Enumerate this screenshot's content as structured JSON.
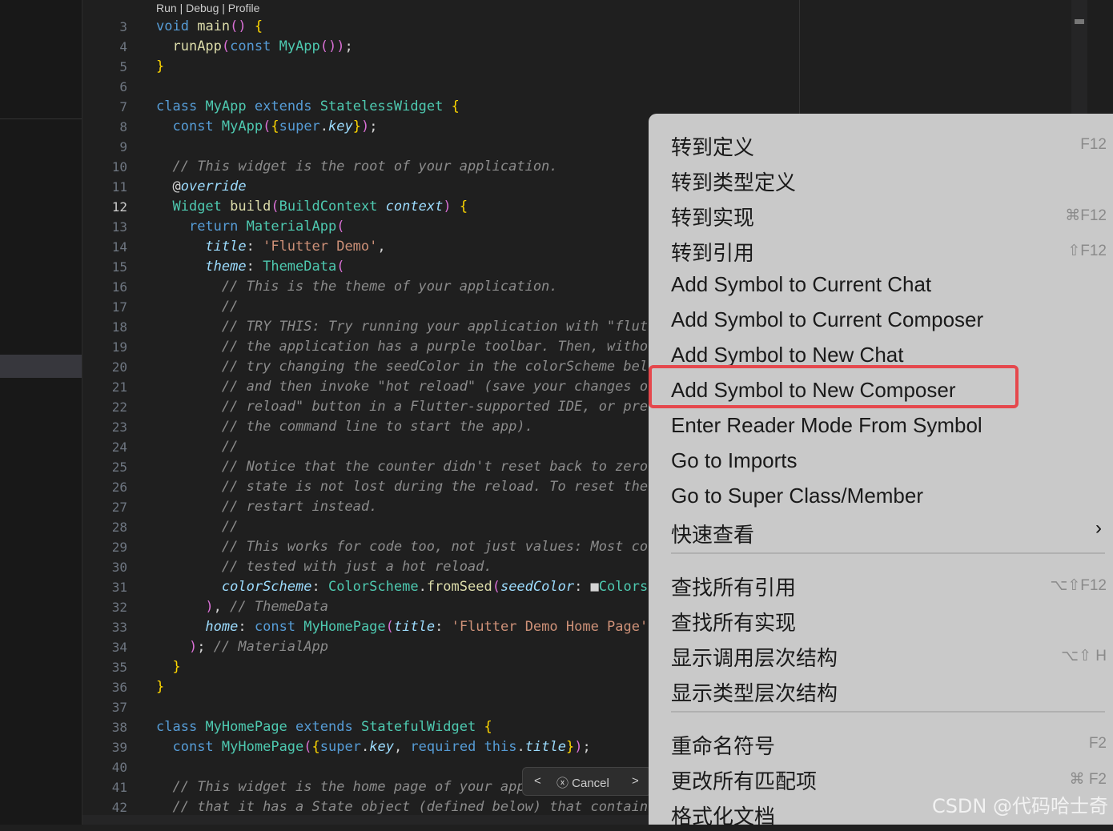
{
  "editor": {
    "codelens": "Run | Debug | Profile",
    "line_numbers": [
      "3",
      "4",
      "5",
      "6",
      "7",
      "8",
      "9",
      "10",
      "11",
      "12",
      "13",
      "14",
      "15",
      "16",
      "17",
      "18",
      "19",
      "20",
      "21",
      "22",
      "23",
      "24",
      "25",
      "26",
      "27",
      "28",
      "29",
      "30",
      "31",
      "32",
      "33",
      "34",
      "35",
      "36",
      "37",
      "38",
      "39",
      "40",
      "41",
      "42"
    ],
    "current_line": "12",
    "lines": [
      "void main() {",
      "  runApp(const MyApp());",
      "}",
      "",
      "class MyApp extends StatelessWidget {",
      "  const MyApp({super.key});",
      "",
      "  // This widget is the root of your application.",
      "  @override",
      "  Widget build(BuildContext context) {",
      "    return MaterialApp(",
      "      title: 'Flutter Demo',",
      "      theme: ThemeData(",
      "        // This is the theme of your application.",
      "        //",
      "        // TRY THIS: Try running your application with \"flutte",
      "        // the application has a purple toolbar. Then, withou",
      "        // try changing the seedColor in the colorScheme belo",
      "        // and then invoke \"hot reload\" (save your changes or",
      "        // reload\" button in a Flutter-supported IDE, or pres",
      "        // the command line to start the app).",
      "        //",
      "        // Notice that the counter didn't reset back to zero;",
      "        // state is not lost during the reload. To reset the s",
      "        // restart instead.",
      "        //",
      "        // This works for code too, not just values: Most code",
      "        // tested with just a hot reload.",
      "        colorScheme: ColorScheme.fromSeed(seedColor: ■Colors",
      "      ), // ThemeData",
      "      home: const MyHomePage(title: 'Flutter Demo Home Page')",
      "    ); // MaterialApp",
      "  }",
      "}",
      "",
      "class MyHomePage extends StatefulWidget {",
      "  const MyHomePage({super.key, required this.title});",
      "",
      "  // This widget is the home page of your app",
      "  // that it has a State object (defined below) that contains"
    ]
  },
  "cancel_bar": {
    "prev": "<",
    "label": "ⓧ Cancel",
    "next": ">"
  },
  "context_menu": {
    "items": [
      {
        "label": "转到定义",
        "shortcut": "F12"
      },
      {
        "label": "转到类型定义",
        "shortcut": ""
      },
      {
        "label": "转到实现",
        "shortcut": "⌘F12"
      },
      {
        "label": "转到引用",
        "shortcut": "⇧F12"
      },
      {
        "label": "Add Symbol to Current Chat",
        "shortcut": ""
      },
      {
        "label": "Add Symbol to Current Composer",
        "shortcut": ""
      },
      {
        "label": "Add Symbol to New Chat",
        "shortcut": ""
      },
      {
        "label": "Add Symbol to New Composer",
        "shortcut": ""
      },
      {
        "label": "Enter Reader Mode From Symbol",
        "shortcut": ""
      },
      {
        "label": "Go to Imports",
        "shortcut": ""
      },
      {
        "label": "Go to Super Class/Member",
        "shortcut": ""
      },
      {
        "label": "快速查看",
        "shortcut": ""
      },
      {
        "label": "查找所有引用",
        "shortcut": "⌥⇧F12"
      },
      {
        "label": "查找所有实现",
        "shortcut": ""
      },
      {
        "label": "显示调用层次结构",
        "shortcut": "⌥⇧ H"
      },
      {
        "label": "显示类型层次结构",
        "shortcut": ""
      },
      {
        "label": "重命名符号",
        "shortcut": "F2"
      },
      {
        "label": "更改所有匹配项",
        "shortcut": "⌘ F2"
      },
      {
        "label": "格式化文档",
        "shortcut": ""
      }
    ],
    "submenu_arrow": "›",
    "highlighted_item": "Add Symbol to New Composer"
  },
  "watermark": "CSDN @代码哈士奇"
}
